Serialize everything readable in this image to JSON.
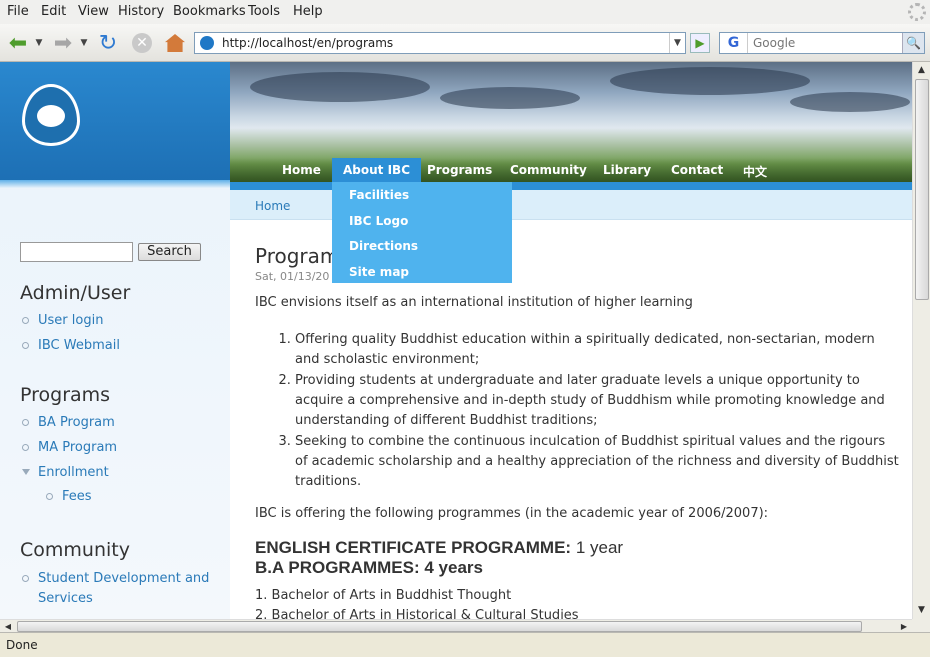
{
  "browser": {
    "menu": [
      "File",
      "Edit",
      "View",
      "History",
      "Bookmarks",
      "Tools",
      "Help"
    ],
    "url": "http://localhost/en/programs",
    "search_placeholder": "Google",
    "status": "Done"
  },
  "site": {
    "sidebar_search_button": "Search",
    "nav": [
      "Home",
      "About IBC",
      "Programs",
      "Community",
      "Library",
      "Contact",
      "中文"
    ],
    "nav_active": "About IBC",
    "dropdown": [
      "Facilities",
      "IBC Logo",
      "Directions",
      "Site map"
    ],
    "breadcrumb": "Home",
    "blocks": {
      "admin_title": "Admin/User",
      "admin_links": [
        "User login",
        "IBC Webmail"
      ],
      "programs_title": "Programs",
      "programs_links": [
        "BA Program",
        "MA Program",
        "Enrollment"
      ],
      "programs_sub": [
        "Fees"
      ],
      "community_title": "Community",
      "community_links": [
        "Student Development and",
        "Services"
      ]
    }
  },
  "content": {
    "title": "Programs",
    "date": "Sat, 01/13/20",
    "intro": "IBC envisions itself as an international institution of higher learning",
    "list": [
      "Offering quality Buddhist education within a spiritually dedicated, non-sectarian, modern and scholastic environment;",
      "Providing students at undergraduate and later graduate levels a unique opportunity to acquire a comprehensive and in-depth study of Buddhism while promoting knowledge and understanding of different Buddhist traditions;",
      "Seeking to combine the continuous inculcation of Buddhist spiritual values and the rigours of academic scholarship and a healthy appreciation of the richness and diversity of Buddhist traditions."
    ],
    "offering": "IBC is offering the following programmes (in the academic year of 2006/2007):",
    "english_cert": "ENGLISH CERTIFICATE PROGRAMME:",
    "english_cert_duration": "1 year",
    "ba_programmes": "B.A PROGRAMMES: 4 years",
    "ba_items": [
      "1. Bachelor of Arts in Buddhist Thought",
      "2. Bachelor of Arts in Historical & Cultural Studies"
    ]
  }
}
